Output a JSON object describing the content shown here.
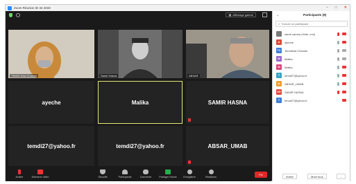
{
  "window": {
    "title": "Zoom Réunion ID 34 2033"
  },
  "topbar": {
    "view_label": "Affichage galerie"
  },
  "tiles": {
    "t1": {
      "label": "TEMDI SAA Chaouki"
    },
    "t2": {
      "label": "Samir Hasna"
    },
    "t3": {
      "label": "ABSAR"
    },
    "t4": {
      "name": "ayeche"
    },
    "t5": {
      "name": "Malika"
    },
    "t6": {
      "name": "SAMIR HASNA"
    },
    "t7": {
      "name": "temdi27@yahoo.fr"
    },
    "t8": {
      "name": "temdi27@yahoo.fr"
    },
    "t9": {
      "name": "ABSAR_UMAB"
    }
  },
  "toolbar": {
    "items": [
      {
        "label": "Activer"
      },
      {
        "label": "Démarrer vidéo"
      },
      {
        "label": "Sécurité"
      },
      {
        "label": "Participants"
      },
      {
        "label": "Converser"
      },
      {
        "label": "Partager l'écran"
      },
      {
        "label": "Enregistrer"
      },
      {
        "label": "Réactions"
      }
    ],
    "end_label": "Fin"
  },
  "panel": {
    "title": "Participants (9)",
    "search_placeholder": "Trouver un participant",
    "participants": [
      {
        "initial": "",
        "name": "sarah samira (Hôte, moi)",
        "color": "#7a7a7a",
        "mic": "#e33",
        "cam": "#e33"
      },
      {
        "initial": "A",
        "name": "ayeche",
        "color": "#e0483b",
        "mic": "#aaa",
        "cam": "#e33"
      },
      {
        "initial": "TC",
        "name": "Temdisaa Chaouki",
        "color": "#3e7ed8",
        "mic": "#aaa",
        "cam": "#aaa"
      },
      {
        "initial": "M",
        "name": "Malika",
        "color": "#9a6ad0",
        "mic": "#aaa",
        "cam": "#aaa"
      },
      {
        "initial": "M",
        "name": "Malika",
        "color": "#d8467b",
        "mic": "#aaa",
        "cam": "#e33"
      },
      {
        "initial": "T",
        "name": "temdi27@yahoo.fr",
        "color": "#3aa4c4",
        "mic": "#aaa",
        "cam": "#e33"
      },
      {
        "initial": "A",
        "name": "ABSAR_UMAB",
        "color": "#f0a030",
        "mic": "#aaa",
        "cam": "#e33"
      },
      {
        "initial": "SH",
        "name": "SAMIR HASNA",
        "color": "#e0483b",
        "mic": "#e33",
        "cam": "#e33"
      },
      {
        "initial": "T",
        "name": "temdi27@yahoo.fr",
        "color": "#3e7ed8",
        "mic": "",
        "cam": "#e33"
      }
    ],
    "invite_label": "Inviter",
    "mute_all_label": "Muet tous",
    "more_label": "..."
  }
}
